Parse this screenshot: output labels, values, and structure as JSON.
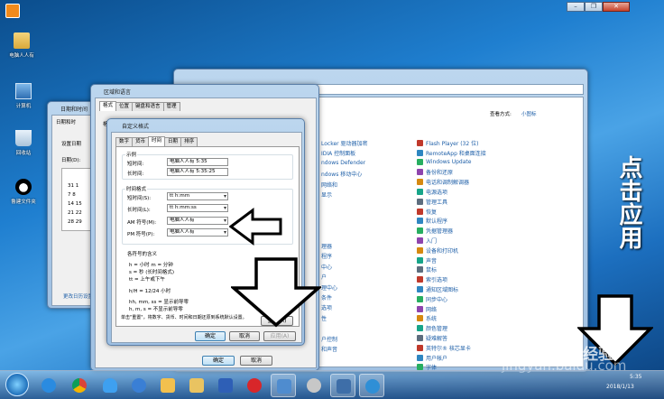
{
  "desktop": {
    "icons": [
      {
        "label": "电脑人人有"
      },
      {
        "label": "计算机"
      },
      {
        "label": "回收站"
      },
      {
        "label": "鲁建文件夹"
      }
    ]
  },
  "control_panel": {
    "view_by_label": "查看方式:",
    "view_by_value": "小图标",
    "left_items": [
      "Locker 驱动器加密",
      "IDIA 控制面板",
      "ndows Defender",
      "ndows 移动中心",
      "网络和",
      "显示",
      "",
      "",
      "",
      "",
      "理器",
      "程序",
      "中心",
      "户",
      "理中心",
      "条件",
      "选项",
      "性",
      "",
      "户控制",
      "和声音",
      ""
    ],
    "right_items": [
      "Flash Player (32 位)",
      "RemoteApp 和桌面连接",
      "Windows Update",
      "备份和还原",
      "电话和调制解调器",
      "电源选项",
      "管理工具",
      "恢复",
      "默认程序",
      "凭据管理器",
      "入门",
      "设备和打印机",
      "声音",
      "鼠标",
      "索引选项",
      "通知区域图标",
      "同步中心",
      "网络",
      "系统",
      "颜色管理",
      "疑难解答",
      "英特尔® 核芯显卡",
      "用户帐户",
      "字体"
    ]
  },
  "datetime_window": {
    "title": "日期和时间",
    "tab1": "日期和时",
    "set_label": "设置日期",
    "date_label": "日期(D):",
    "calendar_rows": [
      "31  1",
      "7   8",
      "14 15",
      "21 22",
      "28 29"
    ],
    "link": "更改日历设置"
  },
  "region_dialog": {
    "title": "区域和语言",
    "tabs": [
      "格式",
      "位置",
      "键盘和语言",
      "管理"
    ],
    "fmt_label": "格式(F):",
    "ok": "确定",
    "cancel": "取消"
  },
  "custom_format": {
    "title": "自定义格式",
    "tabs": [
      "数字",
      "货币",
      "时间",
      "日期",
      "排序"
    ],
    "sample_group": "示例",
    "short_time_label": "短时间:",
    "short_time_value": "电脑人人有 5:35",
    "long_time_label": "长时间:",
    "long_time_value": "电脑人人有 5:35:25",
    "format_group": "时间格式",
    "short_fmt_label": "短时间(S):",
    "short_fmt_value": "tt h:mm",
    "long_fmt_label": "长时间(L):",
    "long_fmt_value": "tt h:mm:ss",
    "am_label": "AM 符号(M):",
    "am_value": "电脑人人有",
    "pm_label": "PM 符号(P):",
    "pm_value": "电脑人人有",
    "notation_title": "各符号的含义",
    "notation_lines": [
      "h = 小时     m = 分钟",
      "s = 秒 (长时间格式)",
      "tt = 上午或下午",
      "h/H = 12/24 小时",
      "hh, mm, ss = 显示前导零",
      "h, m, s = 不显示前导零"
    ],
    "reset_text": "单击\"重置\"，将数字、货币、时间和日期还原到系统默认设置。",
    "reset_button": "重置(R)",
    "ok": "确定",
    "cancel": "取消",
    "apply": "应用(A)"
  },
  "annotation": {
    "text": "点击应用",
    "watermark": "jingyan.baidu.com",
    "brand": "经验"
  },
  "taskbar": {
    "time": "5:35",
    "date": "2018/1/13"
  },
  "colors": {
    "accent": "#1e5fa8",
    "desktop": "#1f7fd0"
  }
}
